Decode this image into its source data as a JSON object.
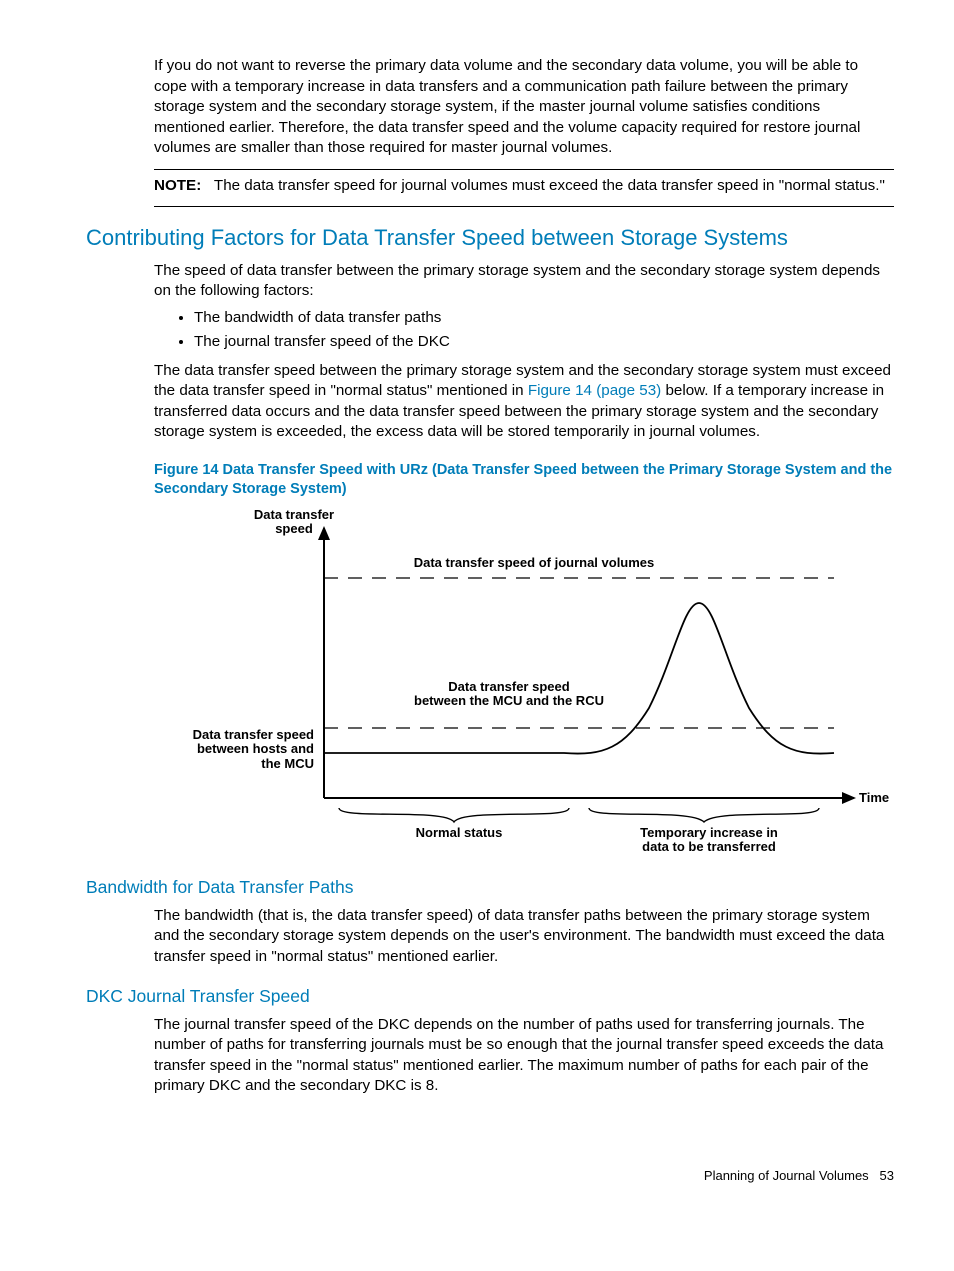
{
  "intro_para": "If you do not want to reverse the primary data volume and the secondary data volume, you will be able to cope with a temporary increase in data transfers and a communication path failure between the primary storage system and the secondary storage system, if the master journal volume satisfies conditions mentioned earlier. Therefore, the data transfer speed and the volume capacity required for restore journal volumes are smaller than those required for master journal volumes.",
  "note_label": "NOTE:",
  "note_text": "The data transfer speed for journal volumes must exceed the data transfer speed in \"normal status.\"",
  "h2": "Contributing Factors for Data Transfer Speed between Storage Systems",
  "contrib_p1": "The speed of data transfer between the primary storage system and the secondary storage system depends on the following factors:",
  "bullets": {
    "b1": "The bandwidth of data transfer paths",
    "b2": "The journal transfer speed of the DKC"
  },
  "contrib_p2a": "The data transfer speed between the primary storage system and the secondary storage system must exceed the data transfer speed in \"normal status\" mentioned in ",
  "contrib_link": "Figure 14 (page 53)",
  "contrib_p2b": " below. If a temporary increase in transferred data occurs and the data transfer speed between the primary storage system and the secondary storage system is exceeded, the excess data will be stored temporarily in journal volumes.",
  "fig_caption": "Figure 14 Data Transfer Speed with URz (Data Transfer Speed between the Primary Storage System and the Secondary Storage System)",
  "fig": {
    "y_label_1": "Data transfer",
    "y_label_2": "speed",
    "top_label": "Data transfer speed of journal volumes",
    "mid_label_1": "Data transfer speed",
    "mid_label_2": "between the MCU and the RCU",
    "left_label_1": "Data transfer speed",
    "left_label_2": "between hosts and",
    "left_label_3": "the MCU",
    "x_label": "Time",
    "bottom_1": "Normal status",
    "bottom_2a": "Temporary increase in",
    "bottom_2b": "data to be transferred"
  },
  "h3a": "Bandwidth for Data Transfer Paths",
  "bw_p": "The bandwidth (that is, the data transfer speed) of data transfer paths between the primary storage system and the secondary storage system depends on the user's environment. The bandwidth must exceed the data transfer speed in \"normal status\" mentioned earlier.",
  "h3b": "DKC Journal Transfer Speed",
  "dkc_p": "The journal transfer speed of the DKC depends on the number of paths used for transferring journals. The number of paths for transferring journals must be so enough that the journal transfer speed exceeds the data transfer speed in the \"normal status\" mentioned earlier. The maximum number of paths for each pair of the primary DKC and the secondary DKC is 8.",
  "footer_text": "Planning of Journal Volumes",
  "page_no": "53",
  "chart_data": {
    "type": "line",
    "title": "Data Transfer Speed with URz",
    "x_axis": "Time (qualitative: normal status → temporary increase)",
    "y_axis": "Data transfer speed (qualitative)",
    "series": [
      {
        "name": "Data transfer speed of journal volumes",
        "shape": "constant high horizontal dashed line"
      },
      {
        "name": "Data transfer speed between the MCU and the RCU",
        "shape": "constant mid-level horizontal dashed line slightly above host curve baseline"
      },
      {
        "name": "Data transfer speed between hosts and the MCU",
        "shape": "low flat during normal status, bell-shaped spike during temporary increase, returns to low"
      }
    ],
    "annotations": [
      "Normal status region left",
      "Temporary increase in data to be transferred region right"
    ]
  }
}
